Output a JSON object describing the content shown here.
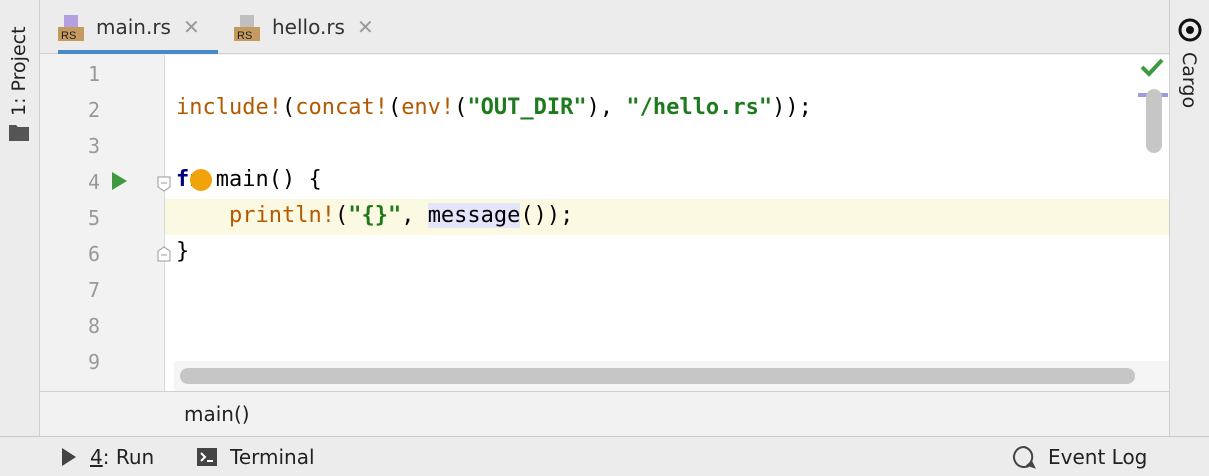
{
  "left_panel": {
    "project_label": "1: Project"
  },
  "right_panel": {
    "cargo_label": "Cargo"
  },
  "tabs": [
    {
      "label": "main.rs",
      "icon": "rust-file-icon",
      "active": true
    },
    {
      "label": "hello.rs",
      "icon": "rust-file-icon",
      "active": false
    }
  ],
  "file_icon_text": "RS",
  "gutter": {
    "line_numbers": [
      "1",
      "2",
      "3",
      "4",
      "5",
      "6",
      "7",
      "8",
      "9"
    ]
  },
  "code": {
    "line2": {
      "inc": "include!",
      "p1": "(",
      "concat": "concat!",
      "p2": "(",
      "env": "env!",
      "p3": "(",
      "s1": "\"OUT_DIR\"",
      "p4": "), ",
      "s2": "\"/hello.rs\"",
      "p5": "));"
    },
    "line4": {
      "kw_a": "f",
      "kw_b": "n",
      "rest": " main() {"
    },
    "line5": {
      "indent": "    ",
      "macro": "println!",
      "p1": "(",
      "s1": "\"{}\"",
      "p2": ", ",
      "call": "message",
      "p3": "());"
    },
    "line6": {
      "text": "}"
    }
  },
  "breadcrumb": {
    "item": "main()"
  },
  "bottom_tools": {
    "run": {
      "num": "4",
      "label": ": Run"
    },
    "terminal": {
      "label": "Terminal"
    },
    "event_log": {
      "label": "Event Log"
    }
  },
  "colors": {
    "accent": "#4a88c7",
    "macro": "#b35900",
    "string": "#1d7a1d",
    "keyword": "#000080",
    "current_line": "#fcf9e3",
    "run_icon": "#3f9a3f",
    "bulb": "#f0a30a"
  }
}
